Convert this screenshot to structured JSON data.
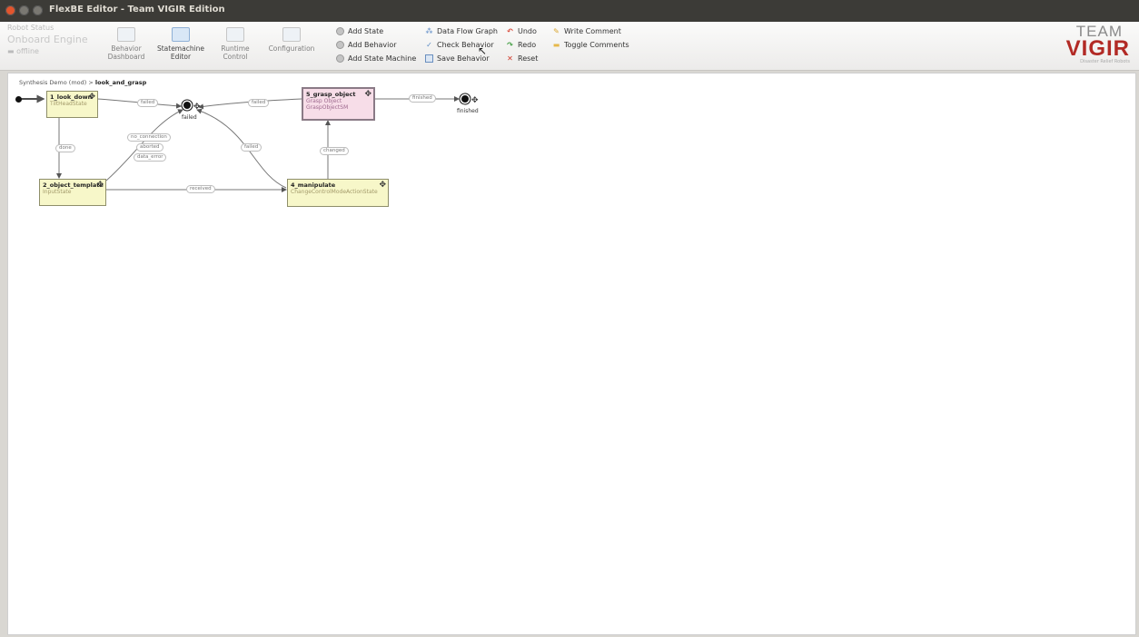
{
  "window": {
    "title": "FlexBE Editor - Team VIGIR Edition"
  },
  "status": {
    "title": "Robot Status",
    "name": "Onboard Engine",
    "mode": "offline"
  },
  "views": [
    {
      "label": "Behavior Dashboard"
    },
    {
      "label": "Statemachine Editor"
    },
    {
      "label": "Runtime Control"
    },
    {
      "label": "Configuration"
    }
  ],
  "tools": {
    "add_state": "Add State",
    "add_behavior": "Add Behavior",
    "add_state_machine": "Add State Machine",
    "data_flow_graph": "Data Flow Graph",
    "check_behavior": "Check Behavior",
    "save_behavior": "Save Behavior",
    "undo": "Undo",
    "redo": "Redo",
    "reset": "Reset",
    "write_comment": "Write Comment",
    "toggle_comments": "Toggle Comments"
  },
  "logo": {
    "team": "TEAM",
    "vigir": "VIGIR",
    "sub": "Disaster Relief Robots"
  },
  "breadcrumb": {
    "root": "Synthesis Demo (mod)",
    "sep": ">",
    "current": "look_and_grasp"
  },
  "states": {
    "look_down": {
      "name": "1_look_down",
      "class": "TiltHeadState"
    },
    "object_template": {
      "name": "2_object_template",
      "class": "InputState"
    },
    "manipulate": {
      "name": "4_manipulate",
      "class": "ChangeControlModeActionState"
    },
    "grasp_object": {
      "name": "5_grasp_object",
      "class": "Grasp Object",
      "class2": "GraspObjectSM"
    }
  },
  "outcomes": {
    "failed": "failed",
    "finished": "finished"
  },
  "transitions": {
    "failed_1": "failed",
    "done": "done",
    "no_connection": "no_connection",
    "aborted": "aborted",
    "data_error": "data_error",
    "received": "received",
    "failed_4": "failed",
    "failed_5": "failed",
    "finished": "finished",
    "changed": "changed"
  }
}
